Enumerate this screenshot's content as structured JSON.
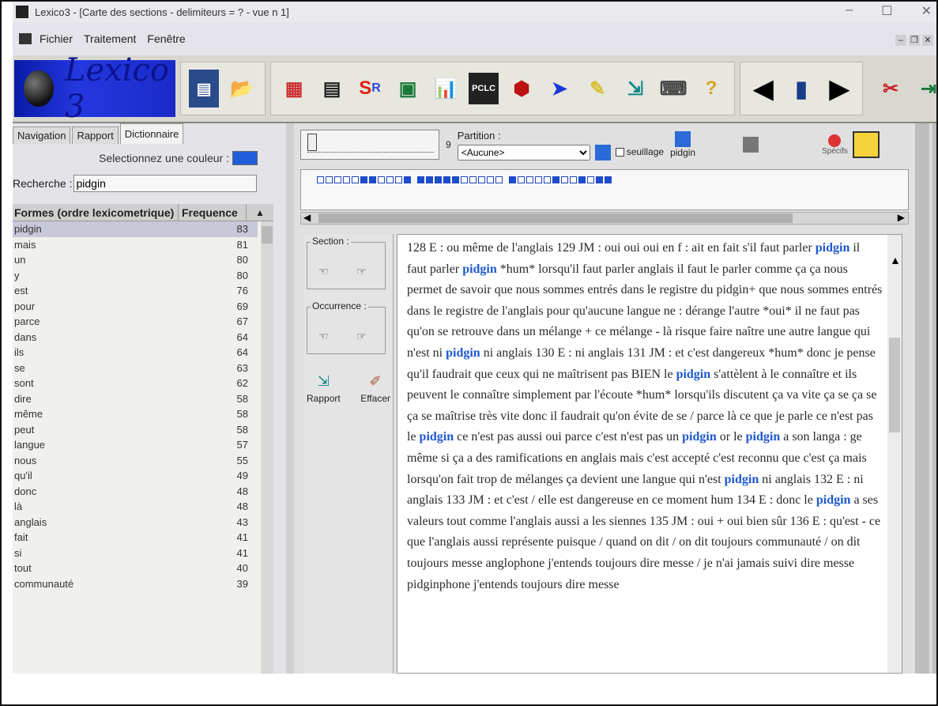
{
  "window": {
    "title": "Lexico3 - [Carte des sections - delimiteurs = ? - vue n 1]",
    "minimize": "–",
    "maximize": "☐",
    "close": "✕"
  },
  "menu": {
    "items": [
      "Fichier",
      "Traitement",
      "Fenêtre"
    ]
  },
  "logo": {
    "text": "Lexico 3"
  },
  "tabs": [
    "Navigation",
    "Rapport",
    "Dictionnaire"
  ],
  "dictionary": {
    "color_label": "Selectionnez une couleur :",
    "color": "#1f5ed8",
    "search_label": "Recherche :",
    "search_value": "pidgin",
    "columns": [
      "Formes (ordre lexicometrique)",
      "Frequence"
    ],
    "rows": [
      {
        "w": "pidgin",
        "f": "83"
      },
      {
        "w": "mais",
        "f": "81"
      },
      {
        "w": "un",
        "f": "80"
      },
      {
        "w": "y",
        "f": "80"
      },
      {
        "w": "est",
        "f": "76"
      },
      {
        "w": "pour",
        "f": "69"
      },
      {
        "w": "parce",
        "f": "67"
      },
      {
        "w": "dans",
        "f": "64"
      },
      {
        "w": "ils",
        "f": "64"
      },
      {
        "w": "se",
        "f": "63"
      },
      {
        "w": "sont",
        "f": "62"
      },
      {
        "w": "dire",
        "f": "58"
      },
      {
        "w": "même",
        "f": "58"
      },
      {
        "w": "peut",
        "f": "58"
      },
      {
        "w": "langue",
        "f": "57"
      },
      {
        "w": "nous",
        "f": "55"
      },
      {
        "w": "qu'il",
        "f": "49"
      },
      {
        "w": "donc",
        "f": "48"
      },
      {
        "w": "là",
        "f": "48"
      },
      {
        "w": "anglais",
        "f": "43"
      },
      {
        "w": "fait",
        "f": "41"
      },
      {
        "w": "si",
        "f": "41"
      },
      {
        "w": "tout",
        "f": "40"
      },
      {
        "w": "communauté",
        "f": "39"
      }
    ]
  },
  "controls": {
    "slider_value": "9",
    "partition_label": "Partition :",
    "partition_value": "<Aucune>",
    "seuillage_label": "seuillage",
    "pidgin_label": "pidgin",
    "specifs_label": "Spécifs"
  },
  "map": {
    "sections": [
      0,
      0,
      0,
      0,
      0,
      1,
      1,
      0,
      0,
      0,
      2,
      1,
      1,
      1,
      1,
      1,
      0,
      0,
      0,
      0,
      0,
      2,
      0,
      0,
      0,
      0,
      1,
      0,
      0,
      1,
      0,
      1,
      1
    ]
  },
  "nav": {
    "section_label": "Section :",
    "occurrence_label": "Occurrence :",
    "rapport": "Rapport",
    "effacer": "Effacer"
  },
  "concordance": [
    {
      "t": "128 E : ou même de l'anglais 129 JM : oui oui oui en f : ait en fait s'il faut parler "
    },
    {
      "t": "pidgin",
      "hl": true
    },
    {
      "t": " il faut parler "
    },
    {
      "t": "pidgin",
      "hl": true
    },
    {
      "t": " *hum* lorsqu'il faut parler anglais il faut le parler comme ça ça nous permet de savoir que nous sommes entrés dans le registre du pidgin+ que nous sommes entrés dans le registre de l'anglais pour qu'aucune langue ne : dérange l'autre *oui* il ne faut pas qu'on se retrouve dans un mélange + ce mélange - là risque faire naître une autre langue qui n'est ni "
    },
    {
      "t": "pidgin",
      "hl": true
    },
    {
      "t": " ni anglais 130 E : ni anglais 131 JM : et c'est dangereux *hum* donc je pense qu'il faudrait que ceux qui ne maîtrisent pas BIEN le "
    },
    {
      "t": "pidgin",
      "hl": true
    },
    {
      "t": " s'attèlent à le connaître et ils peuvent le connaître simplement par l'écoute *hum* lorsqu'ils discutent ça va vite ça se ça se ça se maîtrise très vite donc il faudrait qu'on évite de se / parce là ce que je parle ce n'est pas le "
    },
    {
      "t": "pidgin",
      "hl": true
    },
    {
      "t": " ce n'est pas aussi oui parce c'est n'est pas un "
    },
    {
      "t": "pidgin",
      "hl": true
    },
    {
      "t": " or le "
    },
    {
      "t": "pidgin",
      "hl": true
    },
    {
      "t": " a son langa : ge même si ça a des ramifications en anglais mais c'est accepté c'est reconnu que c'est ça mais lorsqu'on fait trop de mélanges ça devient une langue qui n'est "
    },
    {
      "t": "pidgin",
      "hl": true
    },
    {
      "t": " ni anglais 132 E : ni anglais 133 JM : et c'est / elle est dangereuse en ce moment hum 134 E : donc le "
    },
    {
      "t": "pidgin",
      "hl": true
    },
    {
      "t": " a ses valeurs tout comme l'anglais aussi a les siennes 135 JM : oui + oui bien sûr 136 E : qu'est - ce que l'anglais aussi représente puisque / quand on dit / on dit toujours communauté / on dit toujours messe anglophone j'entends toujours dire messe / je n'ai jamais suivi dire messe pidginphone j'entends toujours dire messe"
    }
  ]
}
